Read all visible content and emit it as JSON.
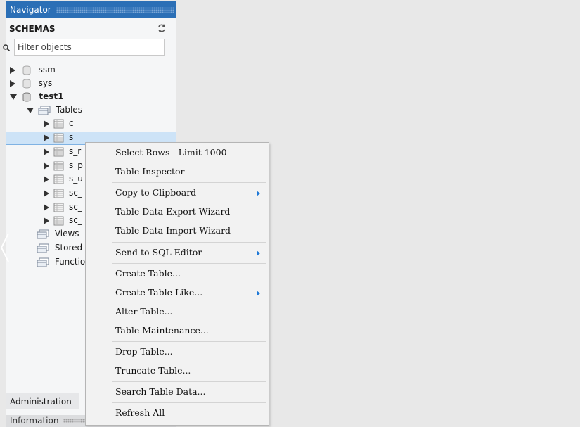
{
  "navigator": {
    "title": "Navigator",
    "schemas_title": "SCHEMAS",
    "filter_placeholder": "Filter objects",
    "schemas": [
      {
        "name": "ssm",
        "expanded": false
      },
      {
        "name": "sys",
        "expanded": false
      },
      {
        "name": "test1",
        "expanded": true
      }
    ],
    "tables_folder": "Tables",
    "tables": [
      "c",
      "s",
      "s_r",
      "s_p",
      "s_u",
      "sc_",
      "sc_",
      "sc_"
    ],
    "folders": [
      "Views",
      "Stored",
      "Functio"
    ],
    "selected_table": "s"
  },
  "bottom": {
    "administration_tab": "Administration",
    "information_label": "Information"
  },
  "context_menu": {
    "items": [
      {
        "label": "Select Rows - Limit 1000",
        "submenu": false
      },
      {
        "label": "Table Inspector",
        "submenu": false
      },
      {
        "label": "Copy to Clipboard",
        "submenu": true
      },
      {
        "label": "Table Data Export Wizard",
        "submenu": false
      },
      {
        "label": "Table Data Import Wizard",
        "submenu": false
      },
      {
        "label": "Send to SQL Editor",
        "submenu": true
      },
      {
        "label": "Create Table...",
        "submenu": false
      },
      {
        "label": "Create Table Like...",
        "submenu": true
      },
      {
        "label": "Alter Table...",
        "submenu": false
      },
      {
        "label": "Table Maintenance...",
        "submenu": false
      },
      {
        "label": "Drop Table...",
        "submenu": false
      },
      {
        "label": "Truncate Table...",
        "submenu": false
      },
      {
        "label": "Search Table Data...",
        "submenu": false
      },
      {
        "label": "Refresh All",
        "submenu": false
      }
    ]
  },
  "colors": {
    "nav_header_bg": "#2b6fb6",
    "selection_bg": "#cde3f7",
    "submenu_arrow": "#1e78d7"
  }
}
